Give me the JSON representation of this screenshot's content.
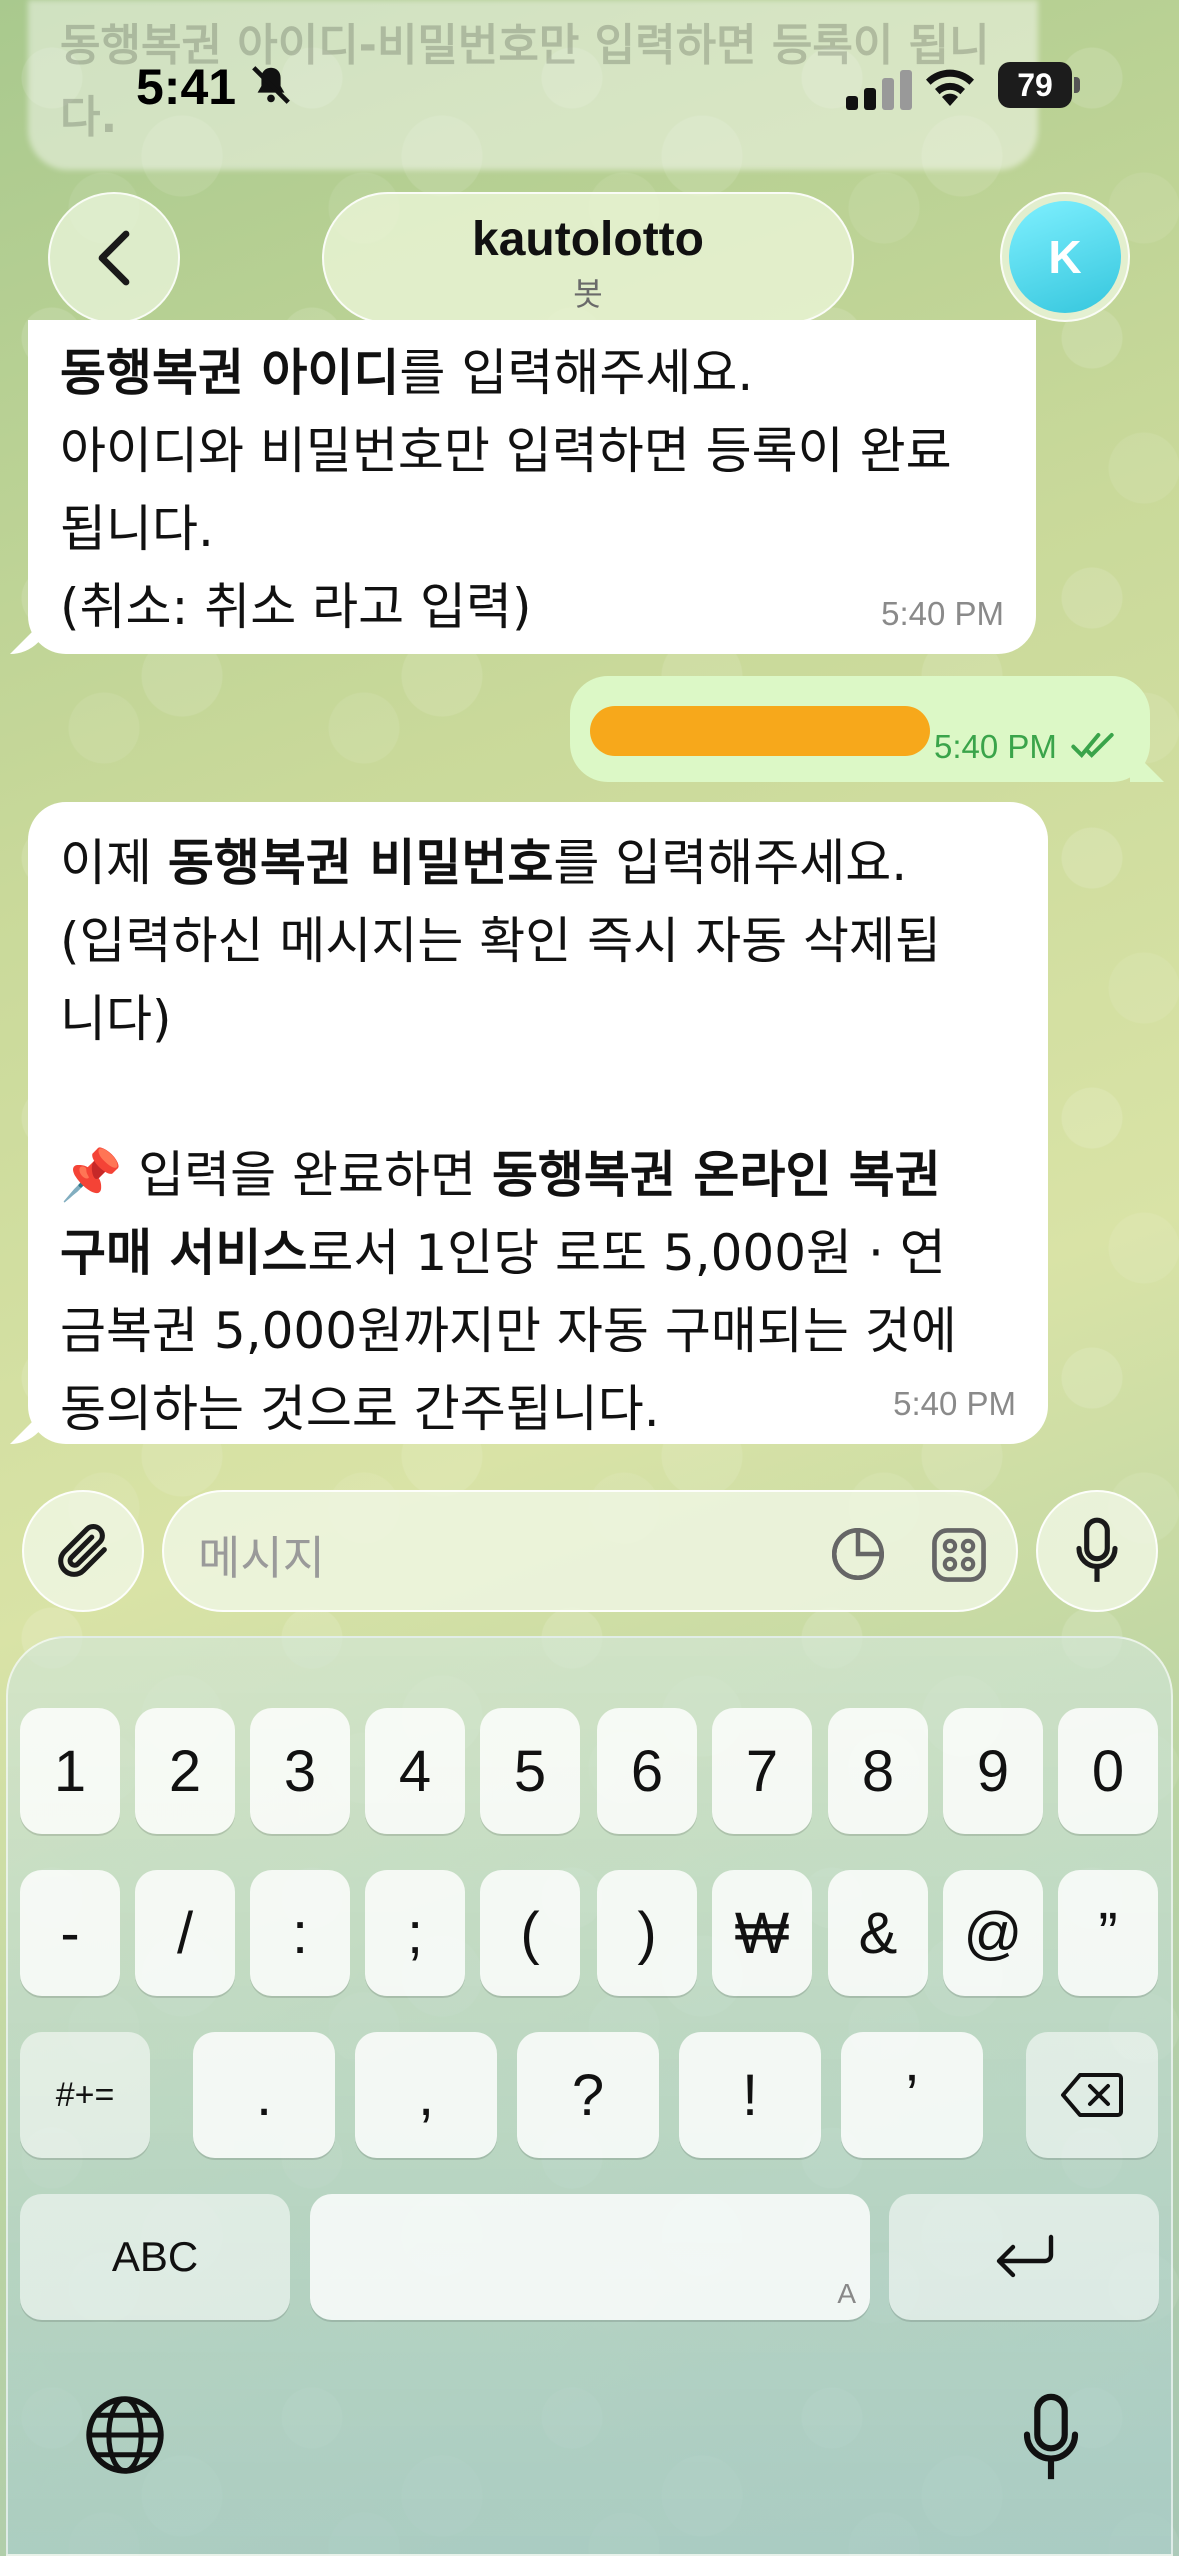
{
  "status_bar": {
    "time": "5:41",
    "battery": "79"
  },
  "background_previous": {
    "text": "동행복권 아이디-비밀번호만 입력하면 등록이 됩니다."
  },
  "header": {
    "title": "kautolotto",
    "subtitle": "봇",
    "avatar_letter": "K"
  },
  "messages": {
    "m1": {
      "line1_bold": "동행복권 아이디",
      "line1_rest": "를 입력해주세요.",
      "line2": "아이디와 비밀번호만 입력하면 등록이 완료",
      "line3": "됩니다.",
      "line4": "(취소: 취소 라고 입력)",
      "time": "5:40 PM"
    },
    "m2_outgoing": {
      "time": "5:40 PM"
    },
    "m3": {
      "line1_pre": "이제 ",
      "line1_bold": "동행복권 비밀번호",
      "line1_rest": "를 입력해주세요.",
      "line2": "(입력하신 메시지는 확인 즉시 자동 삭제됩",
      "line3": "니다)",
      "line5_pre": "📌 입력을 완료하면 ",
      "line5_bold": "동행복권 온라인 복권",
      "line6_bold": "구매 서비스",
      "line6_rest": "로서 1인당 로또 5,000원 · 연",
      "line7": "금복권 5,000원까지만 자동 구매되는 것에",
      "line8": "동의하는 것으로 간주됩니다.",
      "time": "5:40 PM"
    }
  },
  "composer": {
    "placeholder": "메시지"
  },
  "keyboard": {
    "row1": [
      "1",
      "2",
      "3",
      "4",
      "5",
      "6",
      "7",
      "8",
      "9",
      "0"
    ],
    "row2": [
      "-",
      "/",
      ":",
      ";",
      "(",
      ")",
      "₩",
      "&",
      "@",
      "”"
    ],
    "row3": [
      ".",
      ",",
      "?",
      "!",
      "’"
    ],
    "shift_label": "#+=",
    "abc_label": "ABC",
    "space_hint": "A"
  },
  "colors": {
    "outgoing_bubble": "#dcf8c6",
    "incoming_bubble": "#ffffff",
    "redaction": "#f7a81b",
    "avatar": "#35c6dd",
    "read_check": "#3aa44a"
  }
}
